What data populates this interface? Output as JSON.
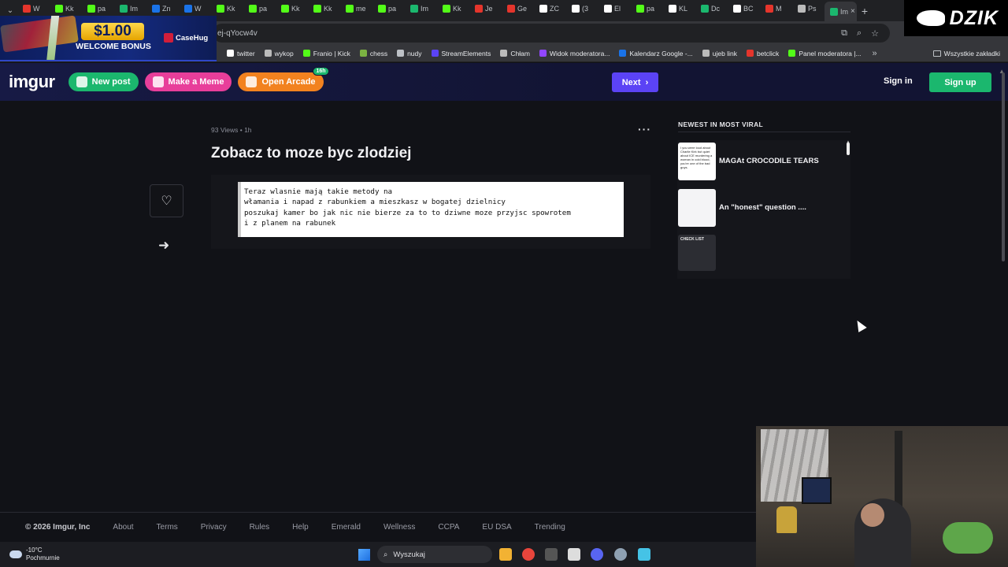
{
  "browser": {
    "tabs": [
      {
        "label": "W",
        "color": "#e5352c"
      },
      {
        "label": "Kk",
        "color": "#53fc18"
      },
      {
        "label": "pa",
        "color": "#53fc18"
      },
      {
        "label": "Im",
        "color": "#1bb76e"
      },
      {
        "label": "Zn",
        "color": "#1a73e8"
      },
      {
        "label": "W",
        "color": "#1a73e8"
      },
      {
        "label": "Kk",
        "color": "#53fc18"
      },
      {
        "label": "pa",
        "color": "#53fc18"
      },
      {
        "label": "Kk",
        "color": "#53fc18"
      },
      {
        "label": "Kk",
        "color": "#53fc18"
      },
      {
        "label": "me",
        "color": "#53fc18"
      },
      {
        "label": "pa",
        "color": "#53fc18"
      },
      {
        "label": "Im",
        "color": "#1bb76e"
      },
      {
        "label": "Kk",
        "color": "#53fc18"
      },
      {
        "label": "Je",
        "color": "#e5352c"
      },
      {
        "label": "Ge",
        "color": "#e5352c"
      },
      {
        "label": "ZC",
        "color": "#ffffff"
      },
      {
        "label": "(3",
        "color": "#ffffff"
      },
      {
        "label": "El",
        "color": "#ffffff"
      },
      {
        "label": "pa",
        "color": "#53fc18"
      },
      {
        "label": "KL",
        "color": "#ffffff"
      },
      {
        "label": "Dc",
        "color": "#1bb76e"
      },
      {
        "label": "BC",
        "color": "#ffffff"
      },
      {
        "label": "M",
        "color": "#e5352c"
      },
      {
        "label": "Ps",
        "color": "#bbbbbb"
      },
      {
        "label": "Im",
        "color": "#1bb76e"
      }
    ],
    "url": "ej-qYocw4v",
    "bookmarks": [
      {
        "label": "twitter",
        "color": "#ffffff"
      },
      {
        "label": "wykop",
        "color": "#bbbbbb"
      },
      {
        "label": "Franio | Kick",
        "color": "#53fc18"
      },
      {
        "label": "chess",
        "color": "#7cb342"
      },
      {
        "label": "nudy",
        "color": "#bdc1c6"
      },
      {
        "label": "StreamElements",
        "color": "#5b43f5"
      },
      {
        "label": "Chłam",
        "color": "#bbbbbb"
      },
      {
        "label": "Widok moderatora...",
        "color": "#9146ff"
      },
      {
        "label": "Kalendarz Google -...",
        "color": "#1a73e8"
      },
      {
        "label": "ujeb link",
        "color": "#bbbbbb"
      },
      {
        "label": "betclick",
        "color": "#e5352c"
      },
      {
        "label": "Panel moderatora |...",
        "color": "#53fc18"
      }
    ],
    "all_bookmarks_label": "Wszystkie zakładki"
  },
  "ad": {
    "price": "$1.00",
    "text": "WELCOME BONUS",
    "brand": "CaseHug"
  },
  "watermark": "DZIK",
  "header": {
    "logo": "imgur",
    "new_post": "New post",
    "make_meme": "Make a Meme",
    "open_arcade": "Open Arcade",
    "arcade_badge": "16h",
    "next": "Next",
    "sign_in": "Sign in",
    "sign_up": "Sign up"
  },
  "post": {
    "views": "93 Views",
    "age": "1h",
    "title": "Zobacz to moze byc zlodziej",
    "image_text": [
      "Teraz wlasnie mają takie metody na",
      "włamania i napad z rabunkiem a mieszkasz w bogatej dzielnicy",
      "poszukaj kamer bo jak nic nie bierze za to to dziwne moze przyjsc spowrotem",
      "i z planem na rabunek"
    ]
  },
  "sidebar": {
    "title": "NEWEST IN MOST VIRAL",
    "items": [
      {
        "label": "MAGAt CROCODILE TEARS",
        "thumb_text": "I you were loud about Charlie Kirk but quiet about ICE murdering a woman in cold blood, you're one of the bad guys."
      },
      {
        "label": "An \"honest\" question ....",
        "thumb_text": ""
      },
      {
        "label": "",
        "thumb_text": "CHECK LIST"
      }
    ]
  },
  "footer": {
    "copyright": "© 2026 Imgur, Inc",
    "links": [
      "About",
      "Terms",
      "Privacy",
      "Rules",
      "Help",
      "Emerald",
      "Wellness",
      "CCPA",
      "EU DSA",
      "Trending"
    ]
  },
  "taskbar": {
    "temp": "-10°C",
    "weather": "Pochmurnie",
    "search": "Wyszukaj"
  }
}
